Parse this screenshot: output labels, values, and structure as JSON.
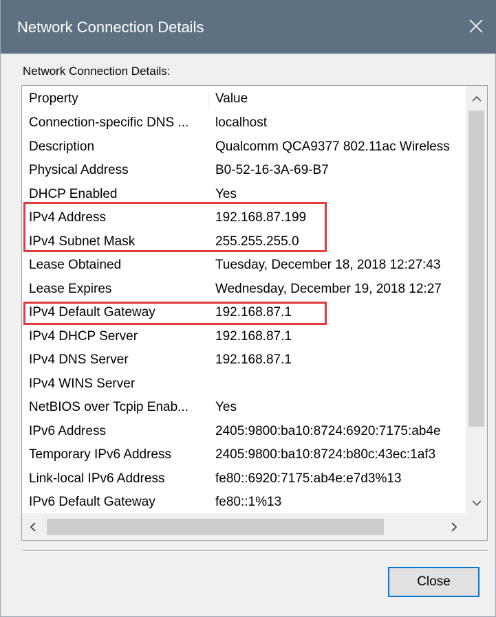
{
  "window": {
    "title": "Network Connection Details",
    "close_icon": "close-icon"
  },
  "group_label": "Network Connection Details:",
  "table": {
    "columns": [
      "Property",
      "Value"
    ],
    "rows": [
      {
        "property": "Connection-specific DNS ...",
        "value": "localhost"
      },
      {
        "property": "Description",
        "value": "Qualcomm QCA9377 802.11ac Wireless"
      },
      {
        "property": "Physical Address",
        "value": "B0-52-16-3A-69-B7"
      },
      {
        "property": "DHCP Enabled",
        "value": "Yes"
      },
      {
        "property": "IPv4 Address",
        "value": "192.168.87.199"
      },
      {
        "property": "IPv4 Subnet Mask",
        "value": "255.255.255.0"
      },
      {
        "property": "Lease Obtained",
        "value": "Tuesday, December 18, 2018 12:27:43"
      },
      {
        "property": "Lease Expires",
        "value": "Wednesday, December 19, 2018 12:27"
      },
      {
        "property": "IPv4 Default Gateway",
        "value": "192.168.87.1"
      },
      {
        "property": "IPv4 DHCP Server",
        "value": "192.168.87.1"
      },
      {
        "property": "IPv4 DNS Server",
        "value": "192.168.87.1"
      },
      {
        "property": "IPv4 WINS Server",
        "value": ""
      },
      {
        "property": "NetBIOS over Tcpip Enab...",
        "value": "Yes"
      },
      {
        "property": "IPv6 Address",
        "value": "2405:9800:ba10:8724:6920:7175:ab4e"
      },
      {
        "property": "Temporary IPv6 Address",
        "value": "2405:9800:ba10:8724:b80c:43ec:1af3"
      },
      {
        "property": "Link-local IPv6 Address",
        "value": "fe80::6920:7175:ab4e:e7d3%13"
      },
      {
        "property": "IPv6 Default Gateway",
        "value": "fe80::1%13"
      }
    ]
  },
  "buttons": {
    "close_label": "Close"
  },
  "colors": {
    "titlebar": "#5e7183",
    "highlight": "#e23b3b",
    "button_border": "#0078d7"
  }
}
